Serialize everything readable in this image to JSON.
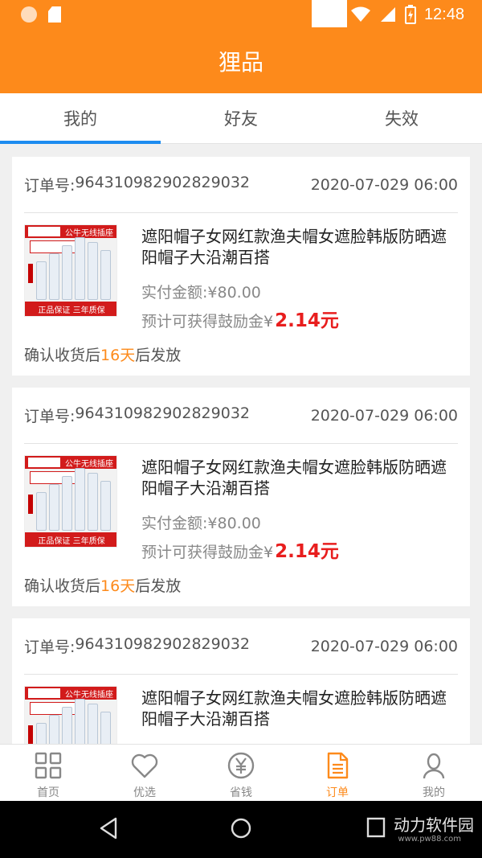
{
  "status_bar": {
    "time": "12:48"
  },
  "app_bar": {
    "title": "狸品"
  },
  "tabs": [
    {
      "label": "我的",
      "active": true
    },
    {
      "label": "好友",
      "active": false
    },
    {
      "label": "失效",
      "active": false
    }
  ],
  "orders": [
    {
      "order_label": "订单号:",
      "order_no": "964310982902829032",
      "datetime": "2020-07-029 06:00",
      "product_title": "遮阳帽子女网红款渔夫帽女遮脸韩版防晒遮阳帽子大沿潮百搭",
      "paid": "实付金额:¥80.00",
      "reward_prefix": "预计可获得鼓励金¥",
      "reward_amount": "2.14元",
      "confirm_before": "确认收货后",
      "confirm_days": "16天",
      "confirm_after": "后发放",
      "thumb": {
        "banner": "公牛无线插座",
        "bottom": "正品保证 三年质保"
      }
    },
    {
      "order_label": "订单号:",
      "order_no": "964310982902829032",
      "datetime": "2020-07-029 06:00",
      "product_title": "遮阳帽子女网红款渔夫帽女遮脸韩版防晒遮阳帽子大沿潮百搭",
      "paid": "实付金额:¥80.00",
      "reward_prefix": "预计可获得鼓励金¥",
      "reward_amount": "2.14元",
      "confirm_before": "确认收货后",
      "confirm_days": "16天",
      "confirm_after": "后发放",
      "thumb": {
        "banner": "公牛无线插座",
        "bottom": "正品保证 三年质保"
      }
    },
    {
      "order_label": "订单号:",
      "order_no": "964310982902829032",
      "datetime": "2020-07-029 06:00",
      "product_title": "遮阳帽子女网红款渔夫帽女遮脸韩版防晒遮阳帽子大沿潮百搭",
      "thumb": {
        "banner": "公牛无线插座",
        "bottom": ""
      }
    }
  ],
  "bottom_nav": [
    {
      "label": "首页",
      "icon": "grid-icon",
      "active": false
    },
    {
      "label": "优选",
      "icon": "heart-icon",
      "active": false
    },
    {
      "label": "省钱",
      "icon": "yen-coin-icon",
      "active": false
    },
    {
      "label": "订单",
      "icon": "document-icon",
      "active": true
    },
    {
      "label": "我的",
      "icon": "user-icon",
      "active": false
    }
  ],
  "watermark": {
    "text": "动力软件园",
    "url": "www.pw88.com"
  },
  "colors": {
    "primary": "#fd8a1b",
    "tab_indicator": "#1d8cf0",
    "reward": "#e81e1e"
  }
}
